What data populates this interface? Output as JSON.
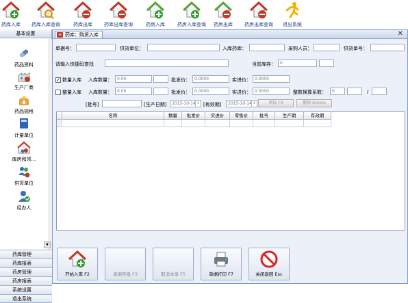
{
  "toolbar": {
    "items": [
      {
        "label": "药库入库",
        "icon": "house-add-icon"
      },
      {
        "label": "药库入库查询",
        "icon": "house-search-icon"
      },
      {
        "label": "药库出库",
        "icon": "house-remove-icon"
      },
      {
        "label": "药库出库查询",
        "icon": "house-search-icon"
      },
      {
        "label": "药房入库",
        "icon": "house-add-icon"
      },
      {
        "label": "药房入库查询",
        "icon": "house-search-icon"
      },
      {
        "label": "药房出库",
        "icon": "house-remove-icon"
      },
      {
        "label": "药房出库查询",
        "icon": "house-search-icon"
      },
      {
        "label": "退出系统",
        "icon": "exit-runner-icon"
      }
    ]
  },
  "sidebar": {
    "header": "基本设置",
    "items": [
      {
        "label": "药品资料",
        "icon": "pills-icon"
      },
      {
        "label": "生产厂商",
        "icon": "factory-icon"
      },
      {
        "label": "药品规格",
        "icon": "specs-icon"
      },
      {
        "label": "计量单位",
        "icon": "book-icon"
      },
      {
        "label": "库房和领...",
        "icon": "warehouse-icon"
      },
      {
        "label": "供货单位",
        "icon": "supplier-icon"
      },
      {
        "label": "经办人",
        "icon": "user-icon"
      }
    ],
    "categories": [
      "药库管理",
      "药库报表",
      "药房管理",
      "药房报表",
      "系统设置",
      "退出系统"
    ]
  },
  "panel": {
    "title": "药库：购货入库",
    "labels": {
      "order_no": "单据号：",
      "supplier": "供货单位：",
      "warehouse": "入库药库：",
      "buyer": "采购人员：",
      "supply_no": "供货单号：",
      "quick_search": "请输入快捷码查找",
      "current_stock": "当前库存：",
      "qty_in": "数量入库",
      "qty": "入库数量：",
      "wholesale": "批发价：",
      "purchase": "实进价：",
      "whole_in": "整量入库",
      "conversion": "整数换算系数：",
      "batch": "[批号]",
      "prod_date": "[生产日期]",
      "expiry": "[有效期]",
      "add_btn": "添加 F9",
      "del_btn": "删除 Delete",
      "slash": "/"
    },
    "values": {
      "current_stock": "0",
      "qty1": "0.00",
      "wholesale1": "0.0000",
      "purchase1": "0.0000",
      "qty2": "0.00",
      "wholesale2": "0.0000",
      "purchase2": "0.0000",
      "conversion": "0",
      "prod_date": "2015-10-14",
      "expiry": "2015-10-14"
    },
    "checkboxes": {
      "qty_in": true,
      "whole_in": false
    },
    "grid_columns": [
      "名称",
      "数量",
      "批发价",
      "实进价",
      "零售价",
      "批号",
      "生产期",
      "有效期"
    ],
    "buttons": [
      {
        "label": "开始入库 F2",
        "icon": "house-add-icon",
        "enabled": true
      },
      {
        "label": "单据存盘 F3",
        "icon": "",
        "enabled": false
      },
      {
        "label": "取消本单 F5",
        "icon": "",
        "enabled": false
      },
      {
        "label": "单据打印 F7",
        "icon": "printer-icon",
        "enabled": true
      },
      {
        "label": "关闭返回 Esc",
        "icon": "no-entry-icon",
        "enabled": true
      }
    ]
  }
}
